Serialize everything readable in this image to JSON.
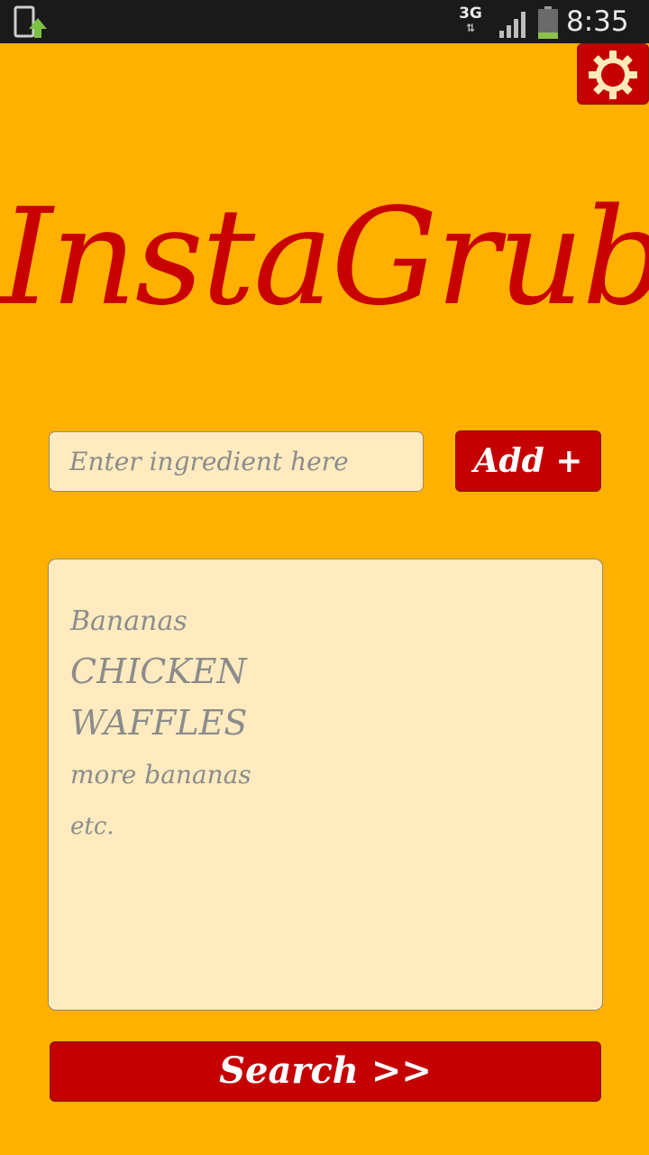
{
  "status_bar": {
    "network": "3G",
    "time": "8:35"
  },
  "header": {
    "settings_icon": "gear-icon"
  },
  "app": {
    "title": "InstaGrub"
  },
  "ingredient_input": {
    "placeholder": "Enter ingredient here",
    "value": ""
  },
  "add_button": {
    "label": "Add +"
  },
  "ingredients": [
    "Bananas",
    "CHICKEN",
    "WAFFLES",
    "more bananas",
    "etc."
  ],
  "search_button": {
    "label": "Search >>"
  },
  "colors": {
    "background": "#FFB000",
    "accent_red": "#C40000",
    "field_bg": "#FFEBBF",
    "placeholder_text": "#8C8C8C"
  }
}
